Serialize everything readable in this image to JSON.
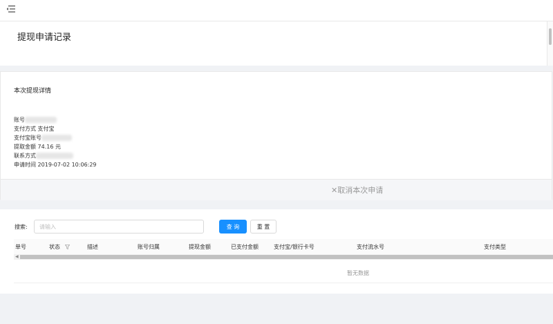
{
  "header": {
    "menu_icon": "menu-fold-icon"
  },
  "page": {
    "title": "提现申请记录"
  },
  "detail": {
    "heading": "本次提现详情",
    "account_label": "账号",
    "pay_method_label": "支付方式",
    "pay_method_value": "支付宝",
    "alipay_account_label": "支付宝账号",
    "amount_label": "提取金额",
    "amount_value": "74.16 元",
    "contact_label": "联系方式",
    "apply_time_label": "申请时间",
    "apply_time_value": "2019-07-02 10:06:29",
    "cancel_label": "✕取消本次申请"
  },
  "search": {
    "label": "搜索:",
    "placeholder": "请输入",
    "query_button": "查 询",
    "reset_button": "重 置"
  },
  "table": {
    "columns": [
      "单号",
      "状态",
      "描述",
      "账号归属",
      "提现金额",
      "已支付金额",
      "支付宝/银行卡号",
      "支付流水号",
      "支付类型"
    ],
    "empty_text": "暂无数据"
  },
  "colors": {
    "primary": "#1890ff",
    "background": "#f0f2f5"
  }
}
